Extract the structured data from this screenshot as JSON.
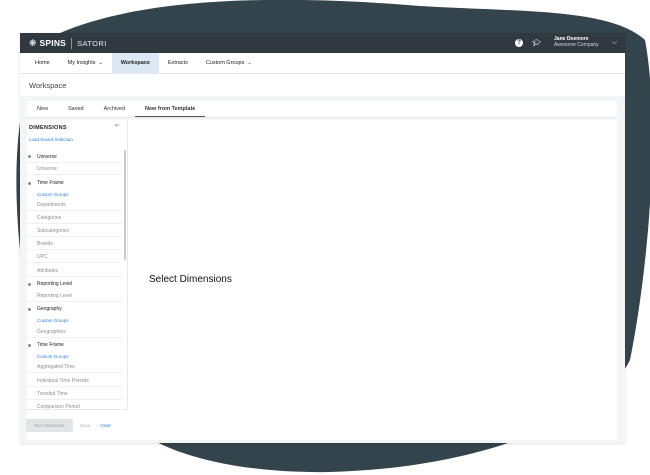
{
  "colors": {
    "topbar": "#303840",
    "blob": "#33444d",
    "link": "#2b7fd6",
    "active_nav": "#dce8f5"
  },
  "brand": {
    "logo": "SPINS",
    "logo_icon": "spins-mark-icon",
    "product": "SATORI"
  },
  "topbar": {
    "help_icon": "?",
    "learn_icon": "graduation-cap-icon",
    "user_name": "Jane Doemore",
    "user_company": "Awesome Company"
  },
  "nav": {
    "items": [
      {
        "label": "Home"
      },
      {
        "label": "My Insights"
      },
      {
        "label": "Workspace",
        "active": true
      },
      {
        "label": "Extracts"
      },
      {
        "label": "Custom Groups"
      }
    ]
  },
  "page": {
    "title": "Workspace"
  },
  "subtabs": {
    "items": [
      {
        "label": "New"
      },
      {
        "label": "Saved"
      },
      {
        "label": "Archived"
      },
      {
        "label": "New from Template",
        "active": true
      }
    ]
  },
  "sidebar": {
    "title": "DIMENSIONS",
    "load_link": "Load Saved Selection",
    "items": [
      {
        "label": "Universe",
        "kind": "header"
      },
      {
        "label": "Universe",
        "kind": "sub"
      },
      {
        "label": "Time Frame",
        "kind": "header"
      },
      {
        "label": "Custom Groups",
        "kind": "link"
      },
      {
        "label": "Departments",
        "kind": "sub"
      },
      {
        "label": "Categories",
        "kind": "sub"
      },
      {
        "label": "Subcategories",
        "kind": "sub"
      },
      {
        "label": "Brands",
        "kind": "sub"
      },
      {
        "label": "UPC",
        "kind": "sub"
      },
      {
        "label": "Attributes",
        "kind": "sub"
      },
      {
        "label": "Reporting Level",
        "kind": "header"
      },
      {
        "label": "Reporting Level",
        "kind": "sub"
      },
      {
        "label": "Geography",
        "kind": "header"
      },
      {
        "label": "Custom Groups",
        "kind": "link"
      },
      {
        "label": "Geographies",
        "kind": "sub"
      },
      {
        "label": "Time Frame",
        "kind": "header"
      },
      {
        "label": "Custom Groups",
        "kind": "link"
      },
      {
        "label": "Aggregated Time",
        "kind": "sub"
      },
      {
        "label": "Individual Time Periods",
        "kind": "sub"
      },
      {
        "label": "Trended Time",
        "kind": "sub"
      },
      {
        "label": "Comparison Period",
        "kind": "sub"
      }
    ],
    "run_label": "Run Selections",
    "save_label": "Save",
    "clear_label": "Clear"
  },
  "content": {
    "placeholder": "Select Dimensions"
  }
}
